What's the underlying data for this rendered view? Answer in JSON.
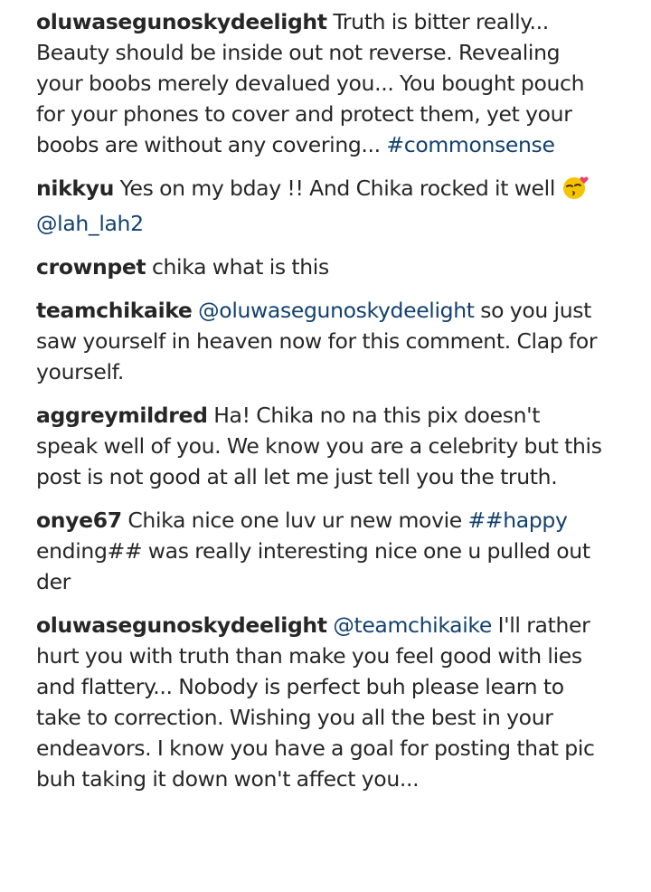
{
  "comments": [
    {
      "username": "oluwasegunoskydeelight",
      "text": "Truth is bitter really... Beauty should be inside out not reverse. Revealing your boobs merely devalued you... You bought pouch for your phones to cover and protect them, yet your boobs are without any covering...",
      "hashtag": "#commonsense"
    },
    {
      "username": "nikkyu",
      "text": "Yes on my bday !! And Chika rocked it well",
      "emoji": "kissing-face-emoji",
      "mention": "@lah_lah2"
    },
    {
      "username": "crownpet",
      "text": "chika what is this"
    },
    {
      "username": "teamchikaike",
      "mention": "@oluwasegunoskydeelight",
      "text": "so you just saw yourself in heaven now for this comment. Clap for yourself."
    },
    {
      "username": "aggreymildred",
      "text": "Ha! Chika no na this pix doesn't speak well of you. We know you are a celebrity but this post is not good at all let me just tell you the truth."
    },
    {
      "username": "onye67",
      "text": "Chika nice one luv ur new movie",
      "hashtag": "##happy",
      "text_after": "ending## was really interesting nice one u pulled out der"
    },
    {
      "username": "oluwasegunoskydeelight",
      "mention": "@teamchikaike",
      "text": "I'll rather hurt you with truth than make you feel good with lies and flattery... Nobody is perfect buh please learn to take to correction. Wishing you all the best in your endeavors. I know you have a goal for posting that pic buh taking it down won't affect you..."
    }
  ],
  "colors": {
    "text": "#262626",
    "link": "#12416f",
    "background": "#ffffff"
  }
}
